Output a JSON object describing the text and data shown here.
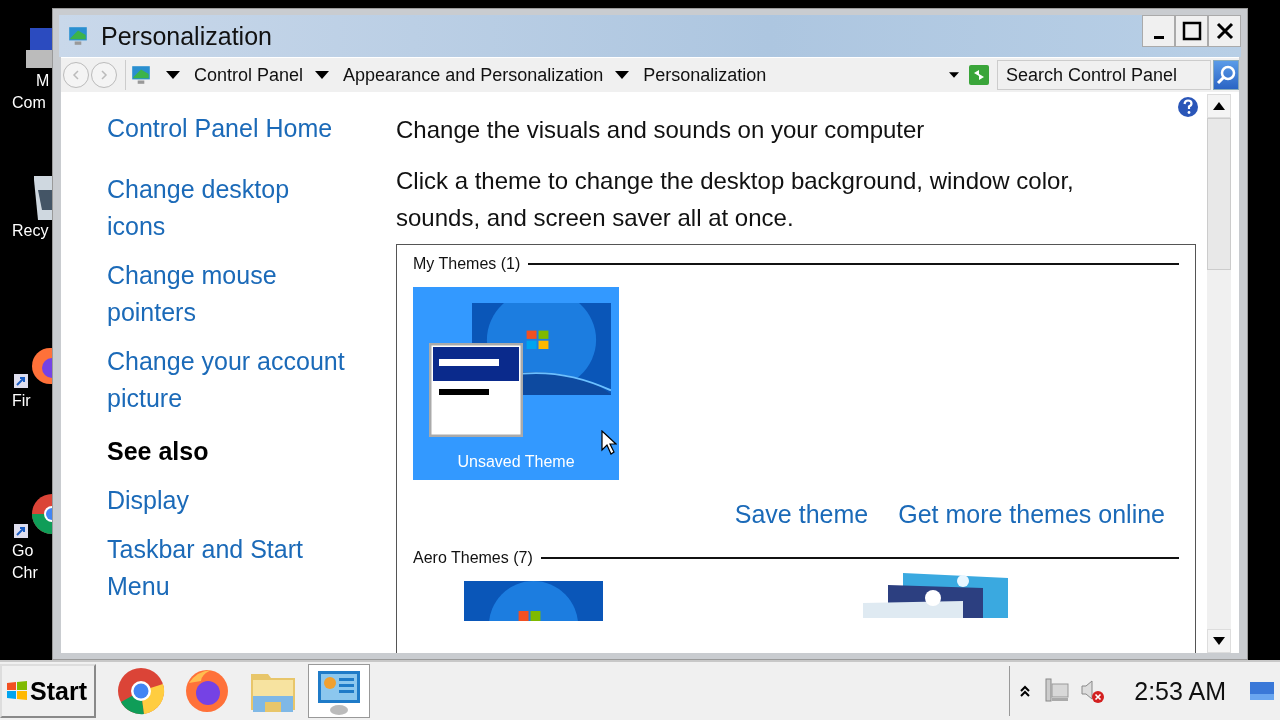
{
  "desktop_icons": [
    {
      "kind": "computer",
      "lines": [
        "M",
        "Com"
      ]
    },
    {
      "kind": "recycle-bin",
      "lines": [
        "Recy"
      ]
    },
    {
      "kind": "firefox",
      "lines": [
        "Fir"
      ]
    },
    {
      "kind": "chrome",
      "lines": [
        "Go",
        "Chr"
      ]
    }
  ],
  "window": {
    "title": "Personalization"
  },
  "address_bar": {
    "breadcrumbs": [
      "Control Panel",
      "Appearance and Personalization",
      "Personalization"
    ]
  },
  "search": {
    "placeholder": "Search Control Panel"
  },
  "sidebar": {
    "links": [
      "Control Panel Home",
      "Change desktop icons",
      "Change mouse pointers",
      "Change your account picture"
    ],
    "see_also_heading": "See also",
    "see_also": [
      "Display",
      "Taskbar and Start Menu"
    ]
  },
  "main": {
    "heading": "Change the visuals and sounds on your computer",
    "description": "Click a theme to change the desktop background, window color, sounds, and screen saver all at once.",
    "theme_groups": [
      {
        "title": "My Themes (1)",
        "themes": [
          {
            "kind": "unsaved",
            "name": "Unsaved Theme",
            "selected": true
          }
        ],
        "actions": [
          "Save theme",
          "Get more themes online"
        ]
      },
      {
        "title": "Aero Themes (7)"
      }
    ]
  },
  "taskbar": {
    "start": "Start",
    "apps": [
      {
        "kind": "chrome",
        "selected": false
      },
      {
        "kind": "firefox",
        "selected": false
      },
      {
        "kind": "explorer",
        "selected": false
      },
      {
        "kind": "control-panel",
        "selected": true
      }
    ],
    "clock": "2:53 AM"
  }
}
